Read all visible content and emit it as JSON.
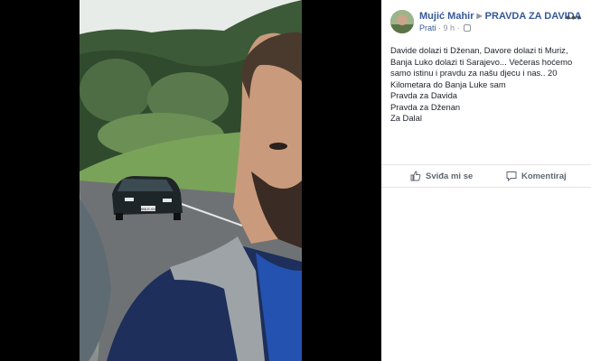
{
  "post": {
    "author": "Mujić Mahir",
    "page": "PRAVDA ZA DAVIDA",
    "follow_label": "Prati",
    "separator": "·",
    "time": "9 h",
    "lines": [
      "Davide dolazi ti Dženan, Davore dolazi ti Muriz, Banja Luko dolazi ti Sarajevo... Večeras hoćemo samo istinu i pravdu za našu djecu i nas.. 20 Kilometara do Banja Luke sam",
      "Pravda za Davida",
      "Pravda za Dženan",
      "Za Dalal"
    ]
  },
  "actions": {
    "like_label": "Sviđa mi se",
    "comment_label": "Komentiraj"
  },
  "video": {
    "license_plate": "M88-E-632"
  },
  "icons": {
    "more": "more-options-icon",
    "like": "thumbs-up-icon",
    "comment": "comment-bubble-icon",
    "privacy": "globe-icon"
  }
}
